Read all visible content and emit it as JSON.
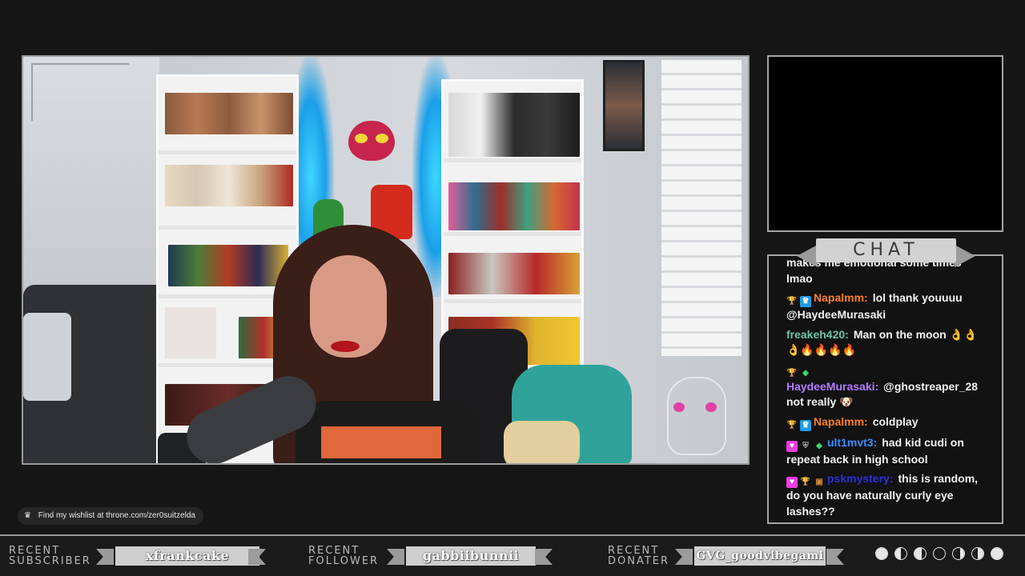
{
  "chat": {
    "title": "CHAT",
    "messages": [
      {
        "user": "",
        "user_color": "#ffffff",
        "badges": [],
        "text": "makes me emotional some times lmao"
      },
      {
        "user": "Napalmm:",
        "user_color": "#ff7f27",
        "badges": [
          "trophy-icon",
          "crown-icon"
        ],
        "text": "lol thank youuuu @HaydeeMurasaki"
      },
      {
        "user": "freakeh420:",
        "user_color": "#6fc3a8",
        "badges": [],
        "text": "Man on the moon 👌👌👌🔥🔥🔥🔥"
      },
      {
        "user": "HaydeeMurasaki:",
        "user_color": "#b57bff",
        "badges": [
          "trophy-icon",
          "gem-icon"
        ],
        "text": "@ghostreaper_28 not really 🐶"
      },
      {
        "user": "Napalmm:",
        "user_color": "#ff7f27",
        "badges": [
          "trophy-icon",
          "crown-icon"
        ],
        "text": "coldplay"
      },
      {
        "user": "ult1mvt3:",
        "user_color": "#3d8cff",
        "badges": [
          "heart-icon",
          "shield-icon",
          "gem-icon"
        ],
        "text": "had kid cudi on repeat back in high school"
      },
      {
        "user": "pskmystery:",
        "user_color": "#2a2fd8",
        "badges": [
          "heart-icon",
          "trophy-icon",
          "box-icon"
        ],
        "text": "this is random, do you have naturally curly eye lashes??"
      }
    ]
  },
  "wishlist": {
    "icon": "crown-icon",
    "text": "Find my wishlist at throne.com/zer0suitzelda"
  },
  "recent": {
    "subscriber": {
      "label_line1": "RECENT",
      "label_line2": "SUBSCRIBER",
      "name": "xfrankcake"
    },
    "follower": {
      "label_line1": "RECENT",
      "label_line2": "FOLLOWER",
      "name": "gabbiibunnii"
    },
    "donater": {
      "label_line1": "RECENT",
      "label_line2": "DONATER",
      "name": "GVG_goodvibegami"
    }
  },
  "moon_phases": [
    0.0,
    0.5,
    0.35,
    1.0,
    0.65,
    0.5,
    0.0
  ],
  "colors": {
    "accent_gray": "#cfcfcf",
    "frame_border": "#9a9a9a",
    "background": "#161616"
  }
}
